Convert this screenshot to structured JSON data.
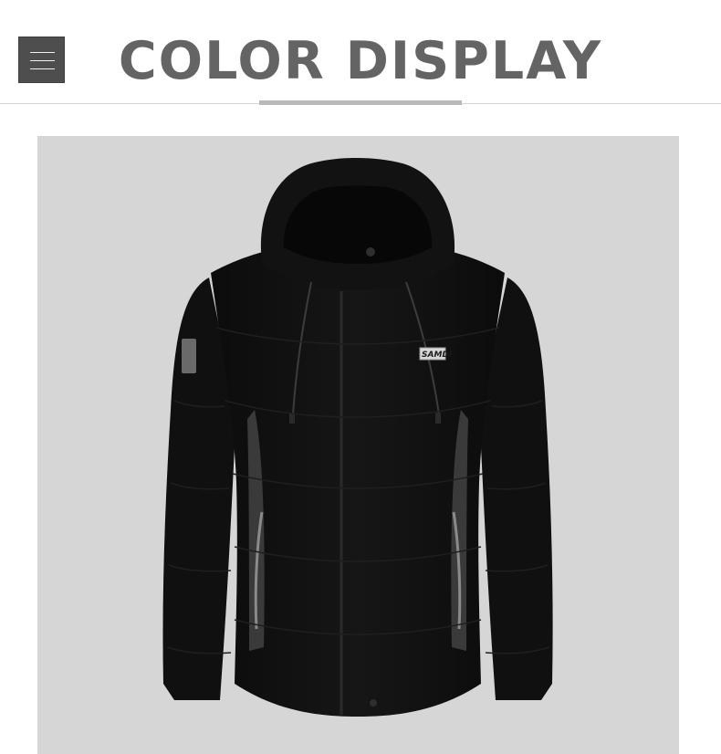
{
  "header": {
    "title": "COLOR DISPLAY",
    "menu_icon": "hamburger-menu-icon"
  },
  "product_image": {
    "subject": "black hooded down jacket",
    "chest_badge_text": "SAMDI",
    "colors": {
      "background": "#d6d6d6",
      "jacket": "#111111",
      "side_panel": "#3a3a3a",
      "accent": "#646464"
    }
  }
}
